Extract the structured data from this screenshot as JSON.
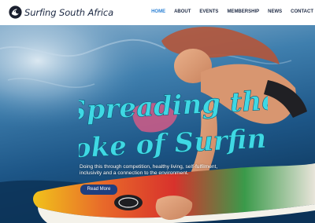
{
  "brand": {
    "name": "Surfing South Africa",
    "logo_icon": "surf-wave-circle-icon"
  },
  "nav": {
    "items": [
      {
        "label": "HOME",
        "active": true
      },
      {
        "label": "ABOUT",
        "active": false
      },
      {
        "label": "EVENTS",
        "active": false
      },
      {
        "label": "MEMBERSHIP",
        "active": false
      },
      {
        "label": "NEWS",
        "active": false
      },
      {
        "label": "CONTACT",
        "active": false
      }
    ]
  },
  "hero": {
    "headline_line1": "Spreading the",
    "headline_line2": "stoke of Surfing!",
    "subtext": "Doing this through competition, healthy living, self-fulfilment, inclusivity and a connection to the environment.",
    "button_label": "Read More"
  },
  "colors": {
    "nav_active": "#2a7fd4",
    "nav_text": "#1f2b45",
    "headline": "#3fd8e4",
    "button": "#1f3f7e"
  }
}
